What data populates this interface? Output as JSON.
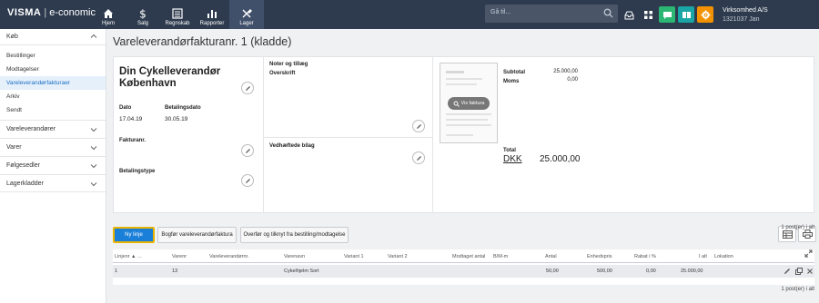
{
  "brand": {
    "logo": "VISMA",
    "product": "e-conomic"
  },
  "nav": [
    {
      "label": "Hjem",
      "icon": "home-icon"
    },
    {
      "label": "Salg",
      "icon": "dollar-icon"
    },
    {
      "label": "Regnskab",
      "icon": "ledger-icon"
    },
    {
      "label": "Rapporter",
      "icon": "bar-chart-icon"
    },
    {
      "label": "Lager",
      "icon": "tools-icon",
      "active": true
    }
  ],
  "search": {
    "placeholder": "Gå til..."
  },
  "company": {
    "name": "Virksomhed A/S",
    "id": "1321037 Jan"
  },
  "colors": {
    "topbar": "#2e3b4e",
    "accent_green": "#2bb673",
    "accent_teal": "#1aa6a6",
    "accent_orange": "#f39200",
    "primary": "#1a7fd9"
  },
  "sidebar": {
    "section": "Køb",
    "items": [
      "Bestillinger",
      "Modtagelser",
      "Vareleverandørfakturaer",
      "Arkiv",
      "Sendt"
    ],
    "active_index": 2,
    "groups": [
      "Vareleverandører",
      "Varer",
      "Følgesedler",
      "Lagerkladder"
    ]
  },
  "page": {
    "title": "Vareleverandørfakturanr. 1 (kladde)"
  },
  "invoice": {
    "supplier": "Din Cykelleverandør København",
    "date_label": "Dato",
    "date": "17.04.19",
    "due_label": "Betalingsdato",
    "due": "30.05.19",
    "invoice_no_label": "Fakturanr.",
    "payment_type_label": "Betalingstype",
    "notes_label": "Noter og tillæg",
    "heading_label": "Overskrift",
    "attachments_label": "Vedhæftede bilag",
    "view_invoice": "Vis faktura",
    "subtotal_label": "Subtotal",
    "subtotal": "25.000,00",
    "vat_label": "Moms",
    "vat": "0,00",
    "total_label": "Total",
    "currency": "DKK",
    "total": "25.000,00"
  },
  "actions": {
    "new_line": "Ny linje",
    "post": "Bogfør vareleverandørfaktura",
    "transfer": "Overfør og tilknyt fra bestilling/modtagelse"
  },
  "pagination": {
    "top": "1 post(er) i alt",
    "bottom": "1 post(er) i alt"
  },
  "table": {
    "headers": [
      "Linjenr ▲ ...",
      "Varenr",
      "Vareleverandørnr.",
      "Varenavn",
      "Variant 1",
      "Variant 2",
      "Modtaget antal",
      "B/M-m",
      "Antal",
      "Enhedspris",
      "Rabat i %",
      "I alt",
      "Lokation"
    ],
    "rows": [
      [
        "1",
        "13",
        "",
        "Cykelhjelm Sort",
        "",
        "",
        "",
        "",
        "50,00",
        "500,00",
        "0,00",
        "25.000,00",
        ""
      ]
    ]
  }
}
